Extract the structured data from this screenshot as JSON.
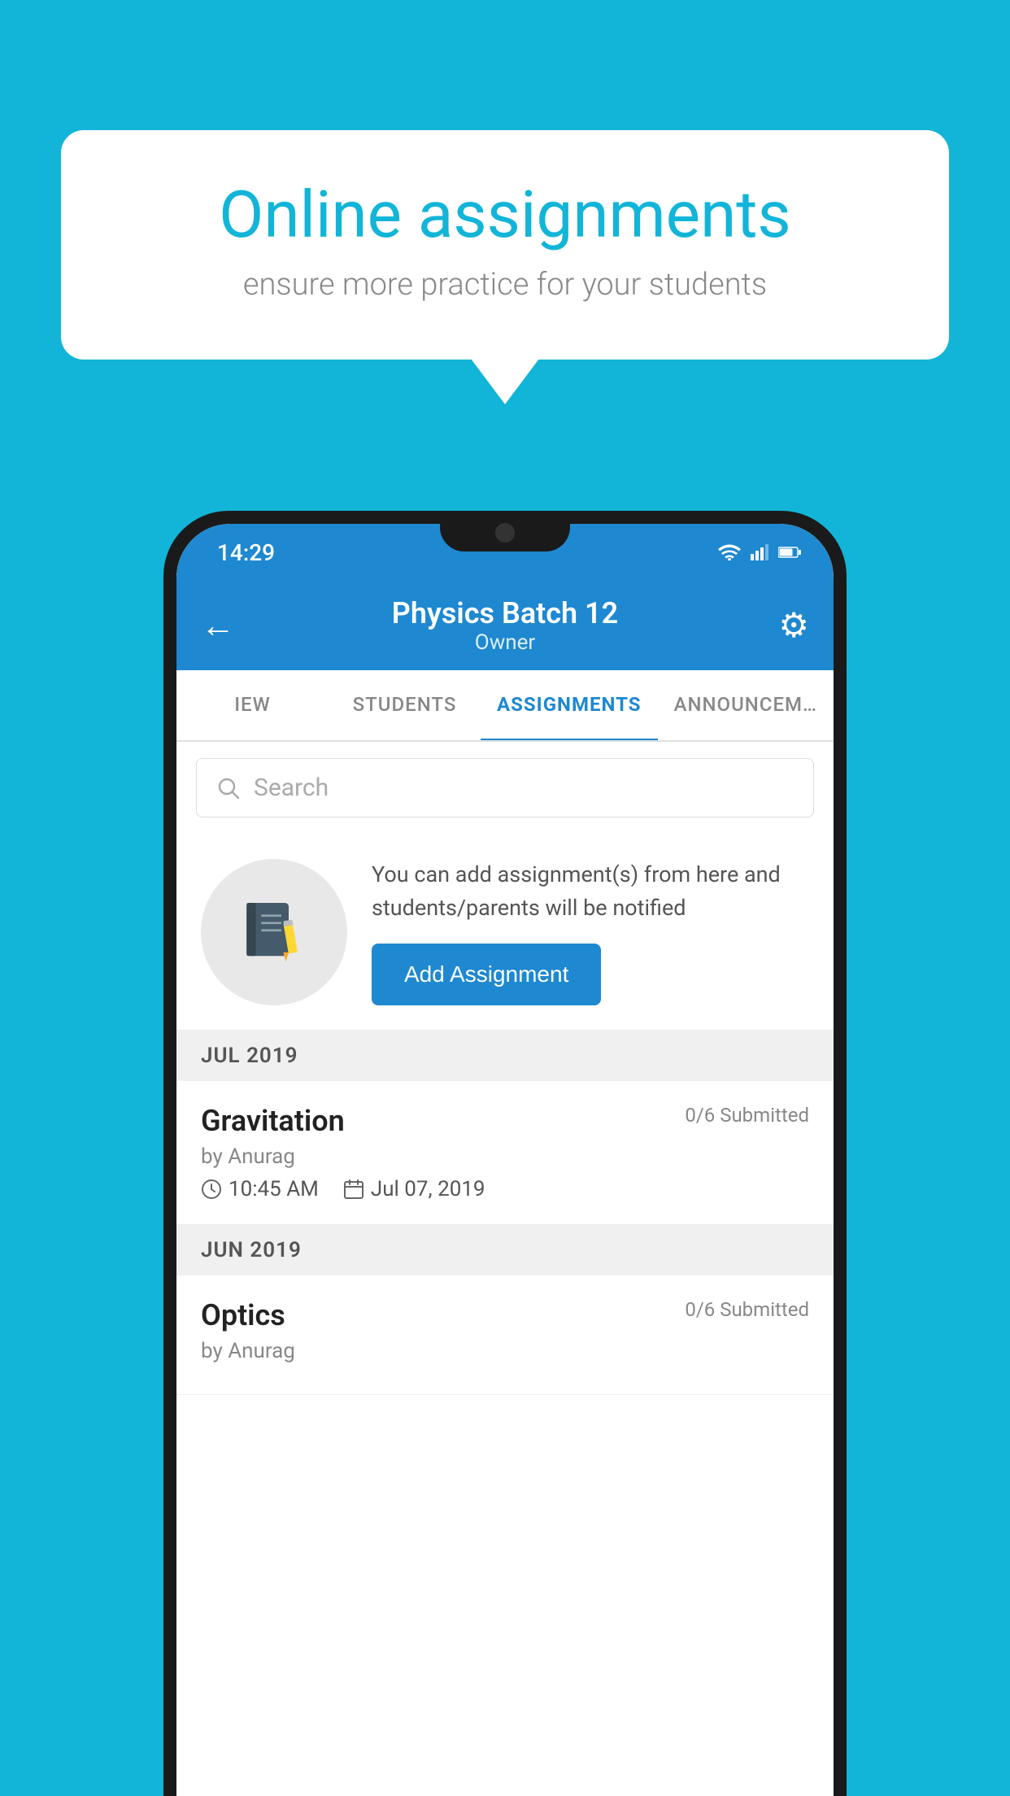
{
  "background_color": "#12B5D8",
  "speech_bubble": {
    "headline": "Online assignments",
    "subtext": "ensure more practice for your students"
  },
  "status_bar": {
    "time": "14:29",
    "wifi": "▼",
    "signal": "▲",
    "battery": "▐"
  },
  "app_bar": {
    "title": "Physics Batch 12",
    "subtitle": "Owner",
    "back_icon": "←",
    "settings_icon": "⚙"
  },
  "tabs": [
    {
      "label": "IEW",
      "active": false
    },
    {
      "label": "STUDENTS",
      "active": false
    },
    {
      "label": "ASSIGNMENTS",
      "active": true
    },
    {
      "label": "ANNOUNCEM…",
      "active": false
    }
  ],
  "search": {
    "placeholder": "Search"
  },
  "info_card": {
    "description": "You can add assignment(s) from here and students/parents will be notified",
    "button_label": "Add Assignment"
  },
  "sections": [
    {
      "header": "JUL 2019",
      "assignments": [
        {
          "name": "Gravitation",
          "submitted": "0/6 Submitted",
          "by": "by Anurag",
          "time": "10:45 AM",
          "date": "Jul 07, 2019"
        }
      ]
    },
    {
      "header": "JUN 2019",
      "assignments": [
        {
          "name": "Optics",
          "submitted": "0/6 Submitted",
          "by": "by Anurag",
          "time": "",
          "date": ""
        }
      ]
    }
  ]
}
